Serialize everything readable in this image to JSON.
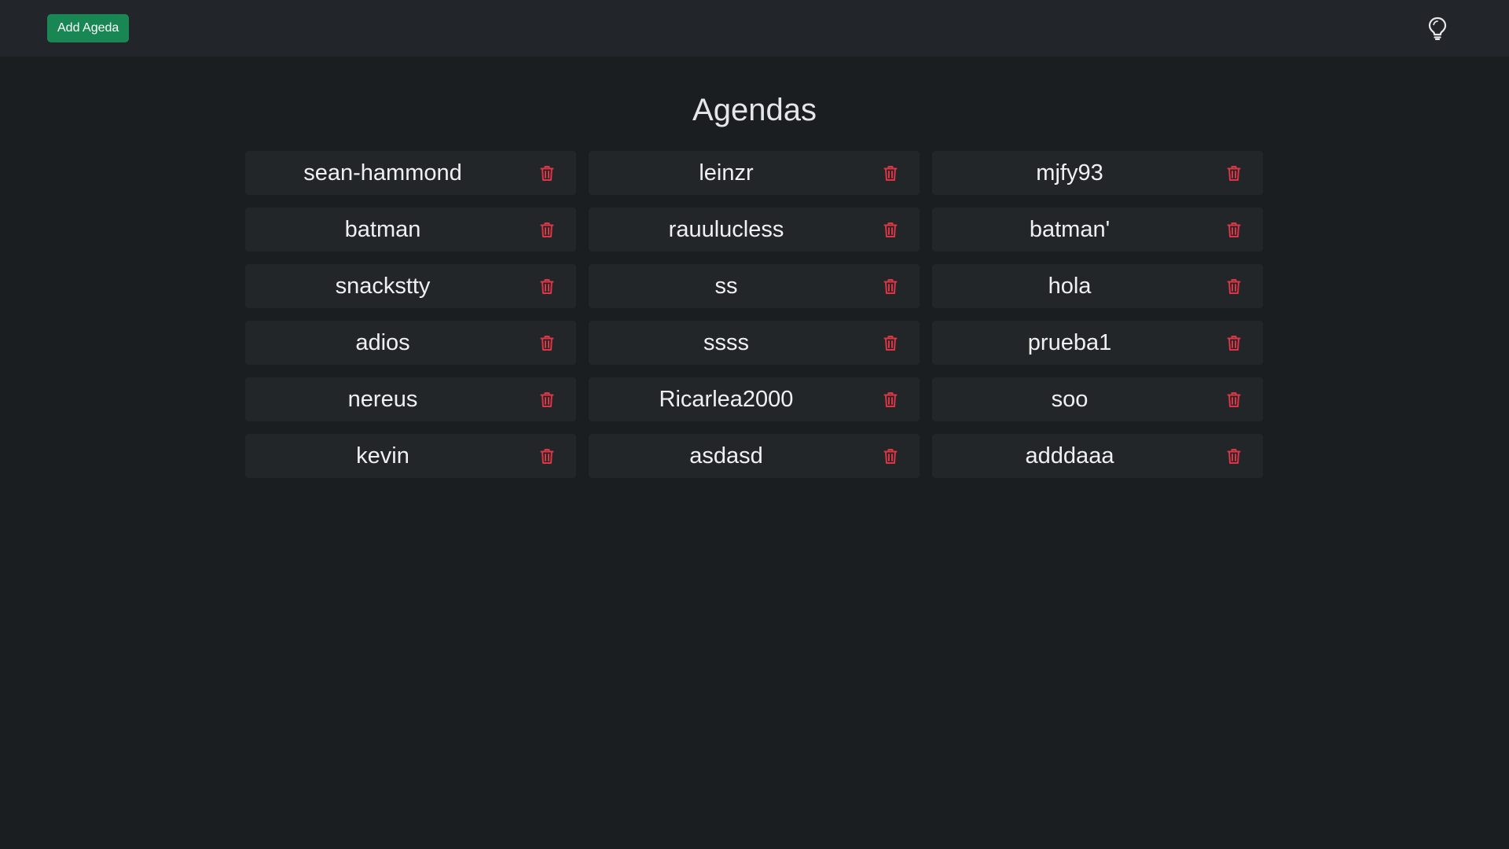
{
  "header": {
    "add_button_label": "Add Ageda",
    "theme_icon": "lightbulb-icon"
  },
  "main": {
    "title": "Agendas",
    "agendas": [
      {
        "name": "sean-hammond"
      },
      {
        "name": "leinzr"
      },
      {
        "name": "mjfy93"
      },
      {
        "name": "batman"
      },
      {
        "name": "rauulucless"
      },
      {
        "name": "batman'"
      },
      {
        "name": "snackstty"
      },
      {
        "name": "ss"
      },
      {
        "name": "hola"
      },
      {
        "name": "adios"
      },
      {
        "name": "ssss"
      },
      {
        "name": "prueba1"
      },
      {
        "name": "nereus"
      },
      {
        "name": "Ricarlea2000"
      },
      {
        "name": "soo"
      },
      {
        "name": "kevin"
      },
      {
        "name": "asdasd"
      },
      {
        "name": "adddaaa"
      }
    ],
    "delete_icon": "trash-icon"
  },
  "colors": {
    "background": "#1b1e21",
    "topbar": "#222529",
    "card": "#232629",
    "accent_green": "#198754",
    "danger_red": "#dc3545"
  }
}
